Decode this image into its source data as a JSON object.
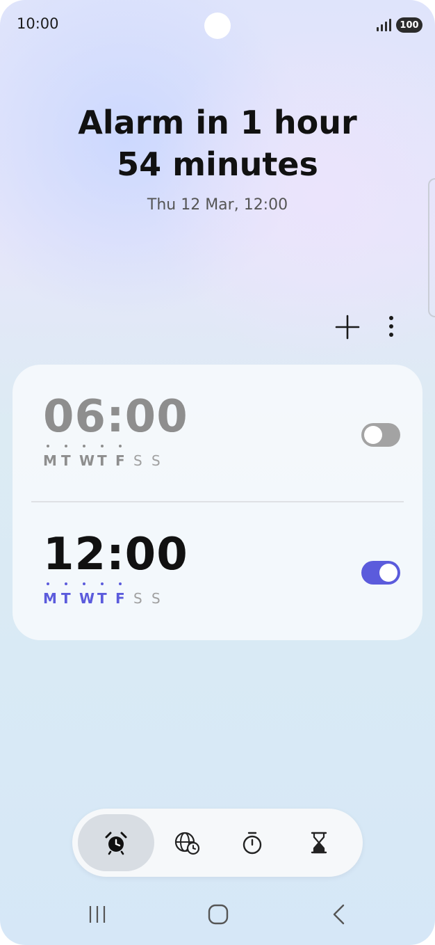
{
  "status_bar": {
    "time": "10:00",
    "battery": "100",
    "icons": [
      "signal-icon",
      "battery-icon"
    ]
  },
  "header": {
    "headline_line1": "Alarm in 1 hour",
    "headline_line2": "54 minutes",
    "next_alarm": "Thu 12 Mar, 12:00"
  },
  "actions": {
    "icons": [
      "plus-icon",
      "more-vertical-icon"
    ]
  },
  "alarms": [
    {
      "time": "06:00",
      "enabled": false,
      "days": [
        {
          "label": "M",
          "active": true
        },
        {
          "label": "T",
          "active": true
        },
        {
          "label": "W",
          "active": true
        },
        {
          "label": "T",
          "active": true
        },
        {
          "label": "F",
          "active": true
        },
        {
          "label": "S",
          "active": false
        },
        {
          "label": "S",
          "active": false
        }
      ]
    },
    {
      "time": "12:00",
      "enabled": true,
      "days": [
        {
          "label": "M",
          "active": true
        },
        {
          "label": "T",
          "active": true
        },
        {
          "label": "W",
          "active": true
        },
        {
          "label": "T",
          "active": true
        },
        {
          "label": "F",
          "active": true
        },
        {
          "label": "S",
          "active": false
        },
        {
          "label": "S",
          "active": false
        }
      ]
    }
  ],
  "tabs": [
    {
      "icon": "alarm-clock-icon",
      "selected": true
    },
    {
      "icon": "world-clock-icon",
      "selected": false
    },
    {
      "icon": "stopwatch-icon",
      "selected": false
    },
    {
      "icon": "timer-hourglass-icon",
      "selected": false
    }
  ],
  "navigation": {
    "icons": [
      "recents-icon",
      "home-icon",
      "back-icon"
    ]
  },
  "colors": {
    "accent": "#5b5bdc",
    "disabled_text": "#8e8e8e",
    "inactive_day": "#a0a0a0",
    "toggle_off": "#a3a3a3",
    "toggle_on": "#5b5bdc",
    "text_primary": "#111111"
  }
}
